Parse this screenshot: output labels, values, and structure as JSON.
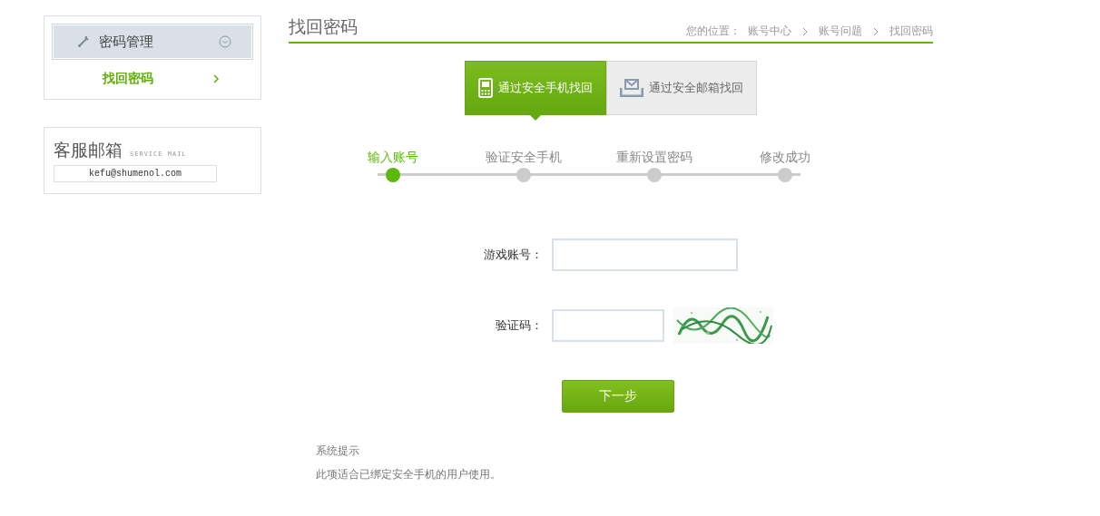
{
  "sidebar": {
    "menu": {
      "title": "密码管理",
      "expanded": true,
      "items": [
        {
          "label": "找回密码",
          "selected": true
        }
      ]
    },
    "service_mail": {
      "title": "客服邮箱",
      "subtitle": "SERVICE MAIL",
      "email": "kefu@shumenol.com"
    }
  },
  "page_title": "找回密码",
  "breadcrumb": {
    "prefix": "您的位置：",
    "items": [
      "账号中心",
      "账号问题",
      "找回密码"
    ]
  },
  "tabs": [
    {
      "label": "通过安全手机找回",
      "kind": "phone",
      "selected": true
    },
    {
      "label": "通过安全邮箱找回",
      "kind": "mail",
      "selected": false
    }
  ],
  "steps": [
    {
      "label": "输入账号",
      "selected": true
    },
    {
      "label": "验证安全手机",
      "selected": false
    },
    {
      "label": "重新设置密码",
      "selected": false
    },
    {
      "label": "修改成功",
      "selected": false
    }
  ],
  "form": {
    "fields": [
      {
        "label": "游戏账号：",
        "kind": "text"
      },
      {
        "label": "验证码：",
        "kind": "captcha"
      }
    ],
    "submit": "下一步"
  },
  "notice": {
    "title": "系统提示",
    "text": "此项适合已绑定安全手机的用户使用。"
  }
}
